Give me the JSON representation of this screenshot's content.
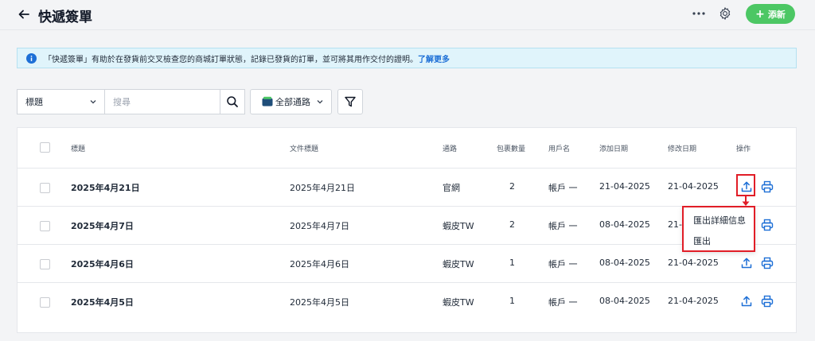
{
  "header": {
    "title": "快遞簽單",
    "add_label": "添新",
    "add_color": "#4cc764"
  },
  "info_banner": {
    "text": "「快遞簽單」有助於在發貨前交叉檢查您的商城訂單狀態，記錄已發貨的訂單，並可將其用作交付的證明。",
    "link": "了解更多"
  },
  "filters": {
    "field_selected": "標題",
    "search_placeholder": "搜尋",
    "channel_selected": "全部通路"
  },
  "table": {
    "columns": {
      "title": "標題",
      "doc_title": "文件標題",
      "channel": "通路",
      "packages": "包裹數量",
      "username": "用戶名",
      "added": "添加日期",
      "modified": "修改日期",
      "actions": "操作"
    },
    "rows": [
      {
        "title": "2025年4月21日",
        "doc_title": "2025年4月21日",
        "channel": "官網",
        "packages": "2",
        "username": "帳戶 一",
        "added": "21-04-2025",
        "modified": "21-04-2025"
      },
      {
        "title": "2025年4月7日",
        "doc_title": "2025年4月7日",
        "channel": "蝦皮TW",
        "packages": "2",
        "username": "帳戶 一",
        "added": "08-04-2025",
        "modified": "21-04-2025"
      },
      {
        "title": "2025年4月6日",
        "doc_title": "2025年4月6日",
        "channel": "蝦皮TW",
        "packages": "1",
        "username": "帳戶 一",
        "added": "08-04-2025",
        "modified": "21-04-2025"
      },
      {
        "title": "2025年4月5日",
        "doc_title": "2025年4月5日",
        "channel": "蝦皮TW",
        "packages": "1",
        "username": "帳戶 一",
        "added": "08-04-2025",
        "modified": "21-04-2025"
      }
    ]
  },
  "export_menu": {
    "items": [
      "匯出詳細信息",
      "匯出"
    ]
  },
  "colors": {
    "accent_blue": "#1d6fd6",
    "highlight_red": "#e11d27"
  }
}
